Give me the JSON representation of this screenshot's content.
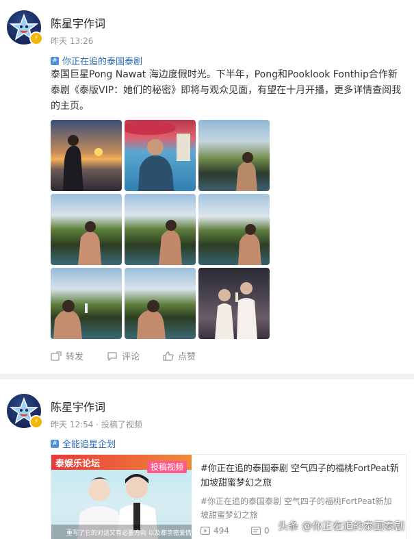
{
  "posts": [
    {
      "username": "陈星宇作词",
      "time": "昨天 13:26",
      "topic": "你正在追的泰国泰剧",
      "text": "泰国巨星Pong Nawat 海边度假时光。下半年，Pong和Pooklook Fonthip合作新泰剧《泰版VIP：她们的秘密》即将与观众见面，有望在十月开播，更多详情查阅我的主页。",
      "actions": {
        "repost": "转发",
        "comment": "评论",
        "like": "点赞"
      }
    },
    {
      "username": "陈星宇作词",
      "time": "昨天 12:54 · 投稿了视频",
      "topic": "全能追星企划",
      "video": {
        "title": "#你正在追的泰国泰剧 空气四子的福桃FortPeat新加坡甜蜜梦幻之旅",
        "desc": "#你正在追的泰国泰剧 空气四子的福桃FortPeat新加坡甜蜜梦幻之旅",
        "badge": "投稿视频",
        "banner": "泰娱乐论坛",
        "subtitle": "重写了它的对话又有必要方向 以及都亲密爱情的所有",
        "plays": "494",
        "comments": "0"
      }
    }
  ],
  "watermark": "头条 @你正在追的泰国泰剧",
  "colors": {
    "link": "#2a6ab8",
    "badge": "#f5b400",
    "divider": "#f2f2f2",
    "muted": "#939393"
  },
  "icons": [
    "star-avatar-icon",
    "verified-badge-icon",
    "topic-hash-icon",
    "repost-icon",
    "comment-icon",
    "like-icon",
    "play-icon",
    "comment-count-icon"
  ]
}
